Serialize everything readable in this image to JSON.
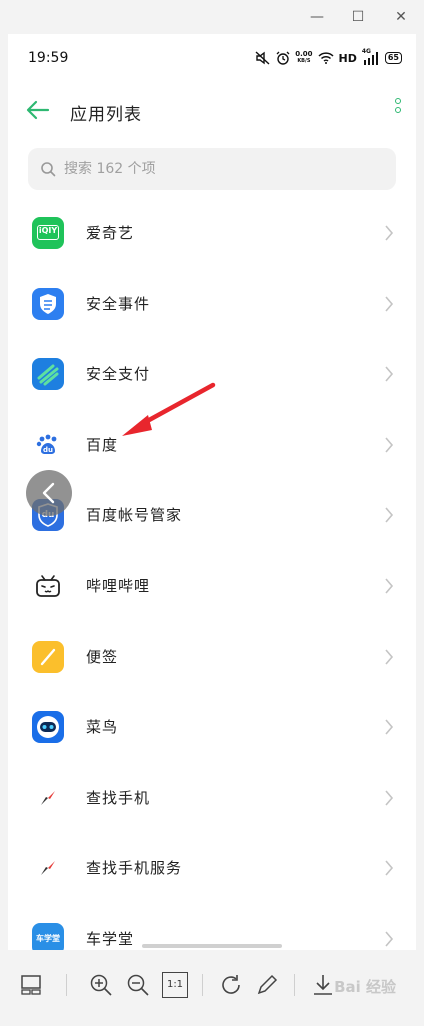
{
  "window": {
    "minimize_glyph": "—",
    "maximize_glyph": "☐",
    "close_glyph": "✕"
  },
  "statusbar": {
    "time": "19:59",
    "net_speed_value": "0.00",
    "net_speed_unit": "KB/S",
    "hd_label": "HD",
    "signal_label": "4G",
    "battery": "65",
    "icons": [
      "mute-icon",
      "alarm-icon",
      "wifi-icon",
      "signal-icon",
      "battery-icon"
    ]
  },
  "header": {
    "title": "应用列表",
    "back_icon": "arrow-left-icon",
    "more_icon": "more-vertical-icon"
  },
  "search": {
    "placeholder": "搜索 162 个项"
  },
  "apps": [
    {
      "label": "爱奇艺",
      "icon": "iqiyi-icon"
    },
    {
      "label": "安全事件",
      "icon": "security-event-icon"
    },
    {
      "label": "安全支付",
      "icon": "secure-payment-icon"
    },
    {
      "label": "百度",
      "icon": "baidu-icon"
    },
    {
      "label": "百度帐号管家",
      "icon": "baidu-account-icon"
    },
    {
      "label": "哔哩哔哩",
      "icon": "bilibili-icon"
    },
    {
      "label": "便签",
      "icon": "notes-icon"
    },
    {
      "label": "菜鸟",
      "icon": "cainiao-icon"
    },
    {
      "label": "查找手机",
      "icon": "find-phone-icon"
    },
    {
      "label": "查找手机服务",
      "icon": "find-phone-service-icon"
    },
    {
      "label": "车学堂",
      "icon": "chexuetang-icon"
    }
  ],
  "iqiyi_icon_text": "iQIY",
  "baidu_icon_text": "du",
  "chexuetang_icon_text": "车学堂",
  "toolbar": {
    "zoom_reset_label": "1:1",
    "watermark": "Bai 经验"
  },
  "colors": {
    "accent": "#2eb872",
    "annotation_arrow": "#e8262d"
  }
}
